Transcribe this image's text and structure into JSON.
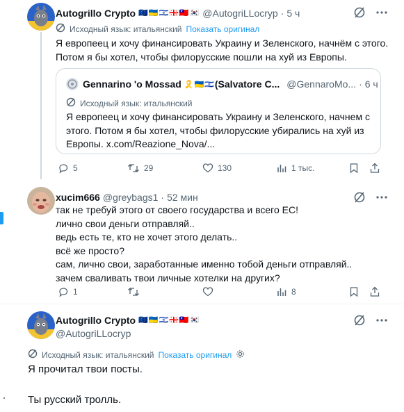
{
  "tweet1": {
    "name": "Autogrillo Crypto",
    "flags": "🇪🇺🇺🇦🇮🇱🇬🇪🇹🇼🇰🇷",
    "handle": "@AutogriLLocryp",
    "time": "5 ч",
    "translate_source": "Исходный язык: итальянский",
    "translate_show": "Показать оригинал",
    "text": "Я европеец и хочу финансировать Украину и Зеленского, начнём с этого.\nПотом я бы хотел, чтобы филорусские пошли на хуй из Европы.",
    "quote": {
      "name": "Gennarino 'o Mossad",
      "flags": "🎗️🇺🇦🇮🇱",
      "name_tail": "(Salvatore C...",
      "handle": "@GennaroMo...",
      "time": "6 ч",
      "translate_source": "Исходный язык: итальянский",
      "text": "Я европеец и хочу финансировать Украину и Зеленского, начнем с\nэтого. Потом я бы хотел, чтобы филорусские убирались на хуй из\nЕвропы. x.com/Reazione_Nova/..."
    },
    "replies": "5",
    "retweets": "29",
    "likes": "130",
    "views": "1 тыс."
  },
  "tweet2": {
    "name": "xucim666",
    "handle": "@greybags1",
    "time": "52 мин",
    "text": "так не требуй этого от своего государства и всего ЕС!\nлично свои деньги отправляй..\nведь есть те, кто не хочет этого делать..\nвсё же просто?\nсам, лично свои, заработанные именно тобой деньги отправляй..\nзачем сваливать твои личные хотелки на других?",
    "replies": "1",
    "views": "8"
  },
  "tweet3": {
    "name": "Autogrillo Crypto",
    "flags": "🇪🇺🇺🇦🇮🇱🇬🇪🇹🇼🇰🇷",
    "handle": "@AutogriLLocryp",
    "translate_source": "Исходный язык: итальянский",
    "translate_show": "Показать оригинал",
    "text1": "Я прочитал твои посты.",
    "text2": "Ты русский тролль."
  },
  "colors": {
    "accent": "#1d9bf0",
    "secondary_text": "#536471",
    "border": "#cfd9de"
  }
}
